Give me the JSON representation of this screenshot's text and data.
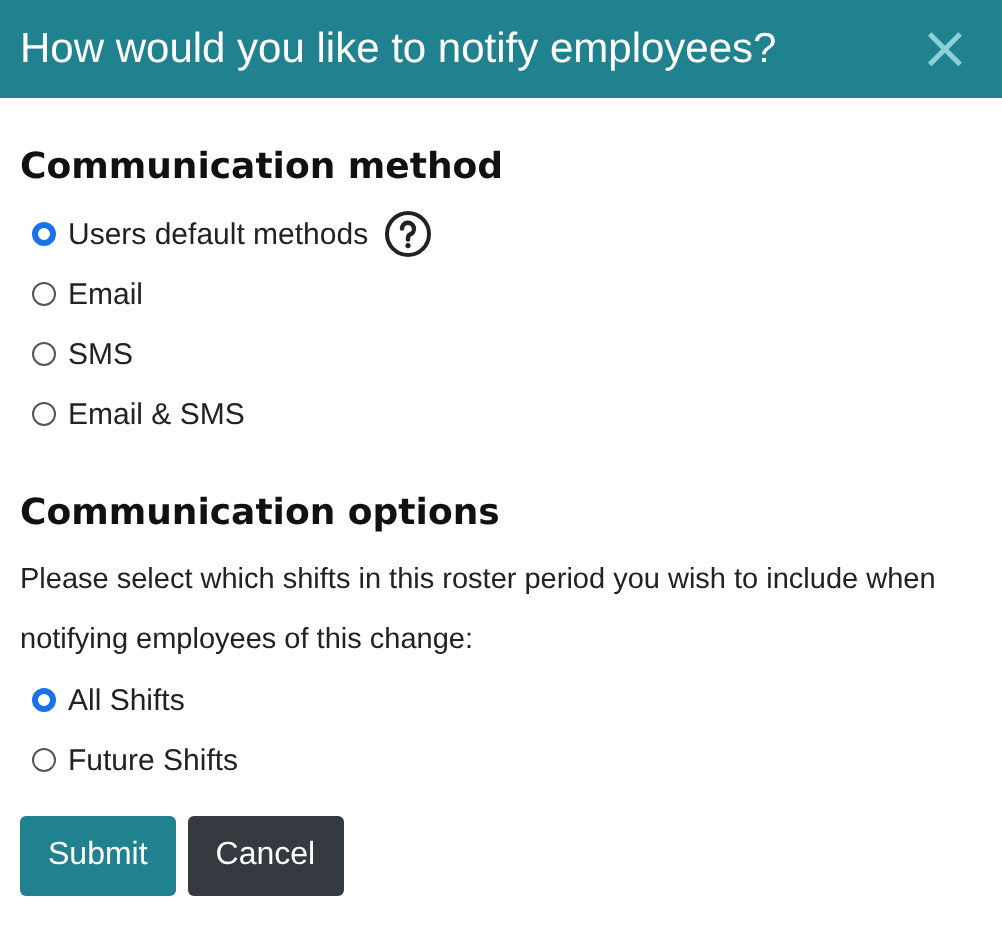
{
  "dialog": {
    "title": "How would you like to notify employees?",
    "close": "×"
  },
  "sections": [
    {
      "heading": "Communication method",
      "radios": [
        {
          "label": "Users default methods",
          "selected": true,
          "help": true
        },
        {
          "label": "Email",
          "selected": false
        },
        {
          "label": "SMS",
          "selected": false
        },
        {
          "label": "Email & SMS",
          "selected": false
        }
      ]
    },
    {
      "heading": "Communication options",
      "description": "Please select which shifts in this roster period you wish to include when notifying employees of this change:",
      "radios": [
        {
          "label": "All Shifts",
          "selected": true
        },
        {
          "label": "Future Shifts",
          "selected": false
        }
      ]
    }
  ],
  "buttons": [
    {
      "label": "Submit",
      "kind": "primary"
    },
    {
      "label": "Cancel",
      "kind": "secondary"
    }
  ]
}
